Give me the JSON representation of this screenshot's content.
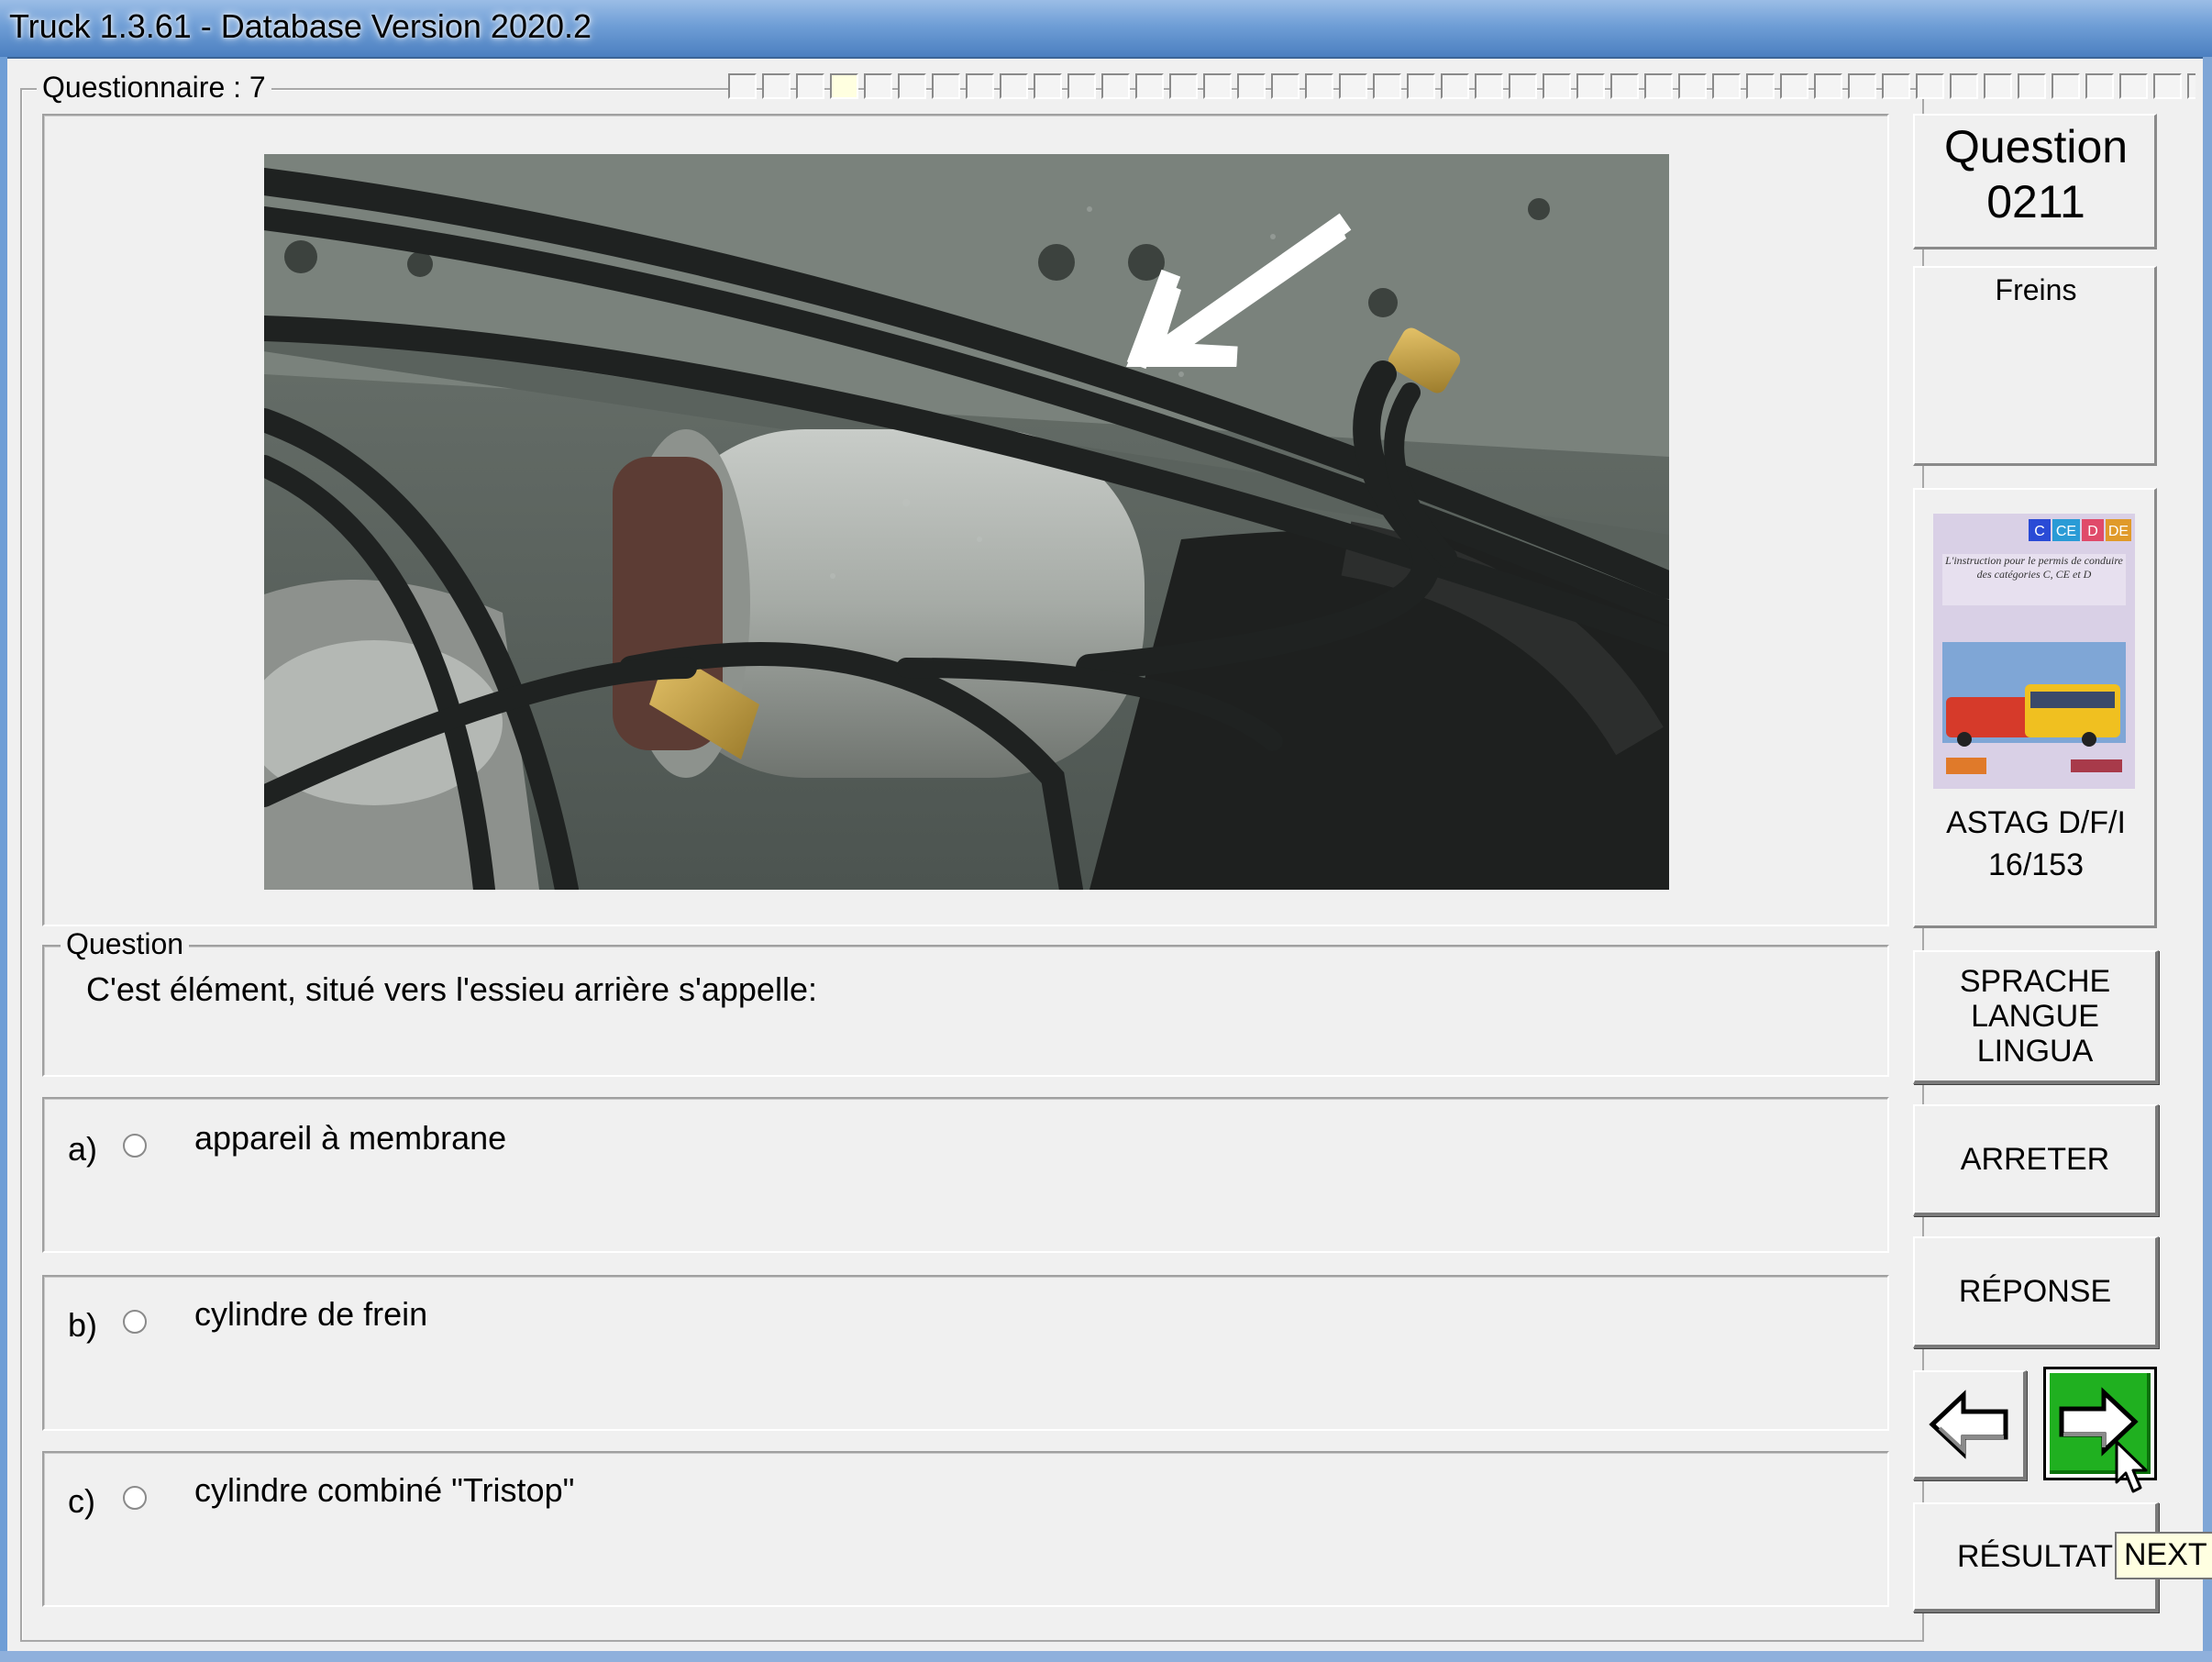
{
  "window": {
    "title": "Truck 1.3.61 - Database Version 2020.2"
  },
  "questionnaire": {
    "label": "Questionnaire : 7",
    "progress_cells": 53,
    "current_index": 3
  },
  "photo": {
    "description_icon": "brake-cylinder-photo",
    "arrow_color": "#ffffff"
  },
  "question": {
    "group_label": "Question",
    "text": "C'est élément, situé vers l'essieu arrière s'appelle:"
  },
  "answers": [
    {
      "letter": "a)",
      "text": "appareil à membrane",
      "selected": false
    },
    {
      "letter": "b)",
      "text": "cylindre de frein",
      "selected": false
    },
    {
      "letter": "c)",
      "text": "cylindre combiné \"Tristop\"",
      "selected": false
    }
  ],
  "right_panel": {
    "question_title": "Question",
    "question_number": "0211",
    "category": "Freins",
    "book": {
      "source": "ASTAG D/F/I",
      "page": "16/153",
      "cover_tag_c": "C",
      "cover_tag_ce": "CE",
      "cover_tag_d": "D",
      "cover_tag_de": "DE",
      "cover_text": "L'instruction pour le permis de conduire des catégories C, CE et D"
    },
    "buttons": {
      "language_1": "SPRACHE",
      "language_2": "LANGUE",
      "language_3": "LINGUA",
      "stop": "ARRETER",
      "answer": "RÉPONSE",
      "result": "RÉSULTAT"
    },
    "tooltip": "NEXT"
  },
  "colors": {
    "next_button_bg": "#20b020",
    "title_gradient_top": "#9bbde6"
  }
}
